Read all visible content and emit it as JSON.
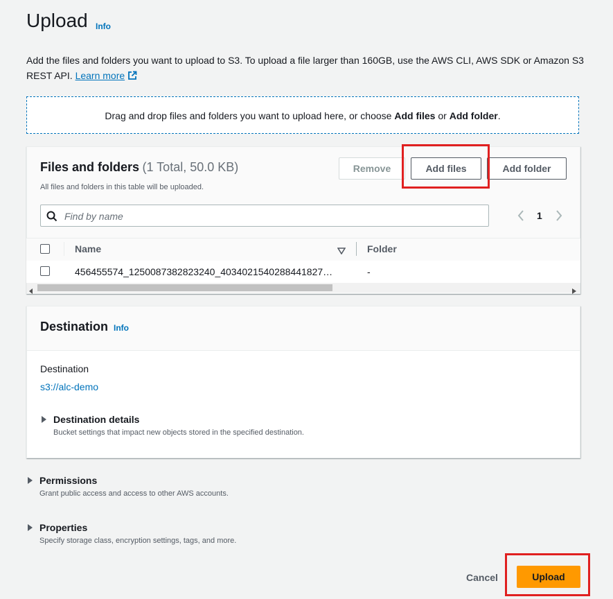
{
  "header": {
    "title": "Upload",
    "info_label": "Info"
  },
  "description": {
    "text": "Add the files and folders you want to upload to S3. To upload a file larger than 160GB, use the AWS CLI, AWS SDK or Amazon S3 REST API.",
    "learn_more": "Learn more"
  },
  "dropzone": {
    "prefix": "Drag and drop files and folders you want to upload here, or choose ",
    "add_files": "Add files",
    "or": " or ",
    "add_folder": "Add folder",
    "suffix": "."
  },
  "files_panel": {
    "title": "Files and folders",
    "count": "(1 Total, 50.0 KB)",
    "subtitle": "All files and folders in this table will be uploaded.",
    "remove_label": "Remove",
    "add_files_label": "Add files",
    "add_folder_label": "Add folder",
    "search_placeholder": "Find by name",
    "page_number": "1",
    "columns": {
      "name": "Name",
      "folder": "Folder"
    },
    "rows": [
      {
        "name": "456455574_1250087382823240_4034021540288441827…",
        "folder": "-"
      }
    ]
  },
  "destination_panel": {
    "title": "Destination",
    "info_label": "Info",
    "label": "Destination",
    "value": "s3://alc-demo",
    "details_title": "Destination details",
    "details_desc": "Bucket settings that impact new objects stored in the specified destination."
  },
  "permissions": {
    "title": "Permissions",
    "desc": "Grant public access and access to other AWS accounts."
  },
  "properties": {
    "title": "Properties",
    "desc": "Specify storage class, encryption settings, tags, and more."
  },
  "footer": {
    "cancel_label": "Cancel",
    "upload_label": "Upload"
  },
  "colors": {
    "accent": "#0073bb",
    "primary_button": "#ff9900",
    "highlight": "#e02020"
  }
}
